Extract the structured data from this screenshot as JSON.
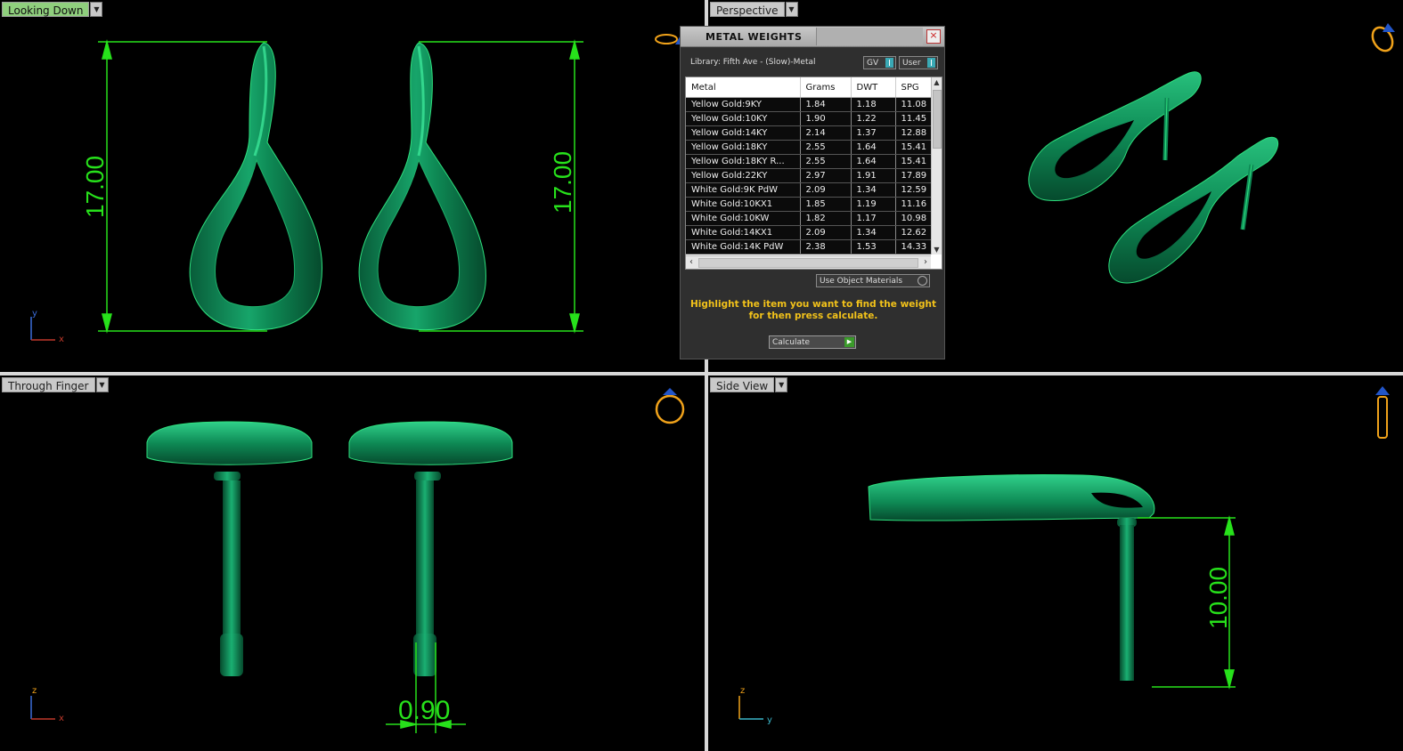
{
  "viewports": {
    "top_left": {
      "label": "Looking Down",
      "dim_left": "17.00",
      "dim_right": "17.00",
      "axis_a": "y",
      "axis_b": "x"
    },
    "top_right": {
      "label": "Perspective"
    },
    "bottom_left": {
      "label": "Through Finger",
      "dim": "0.90",
      "axis_a": "z",
      "axis_b": "x"
    },
    "bottom_right": {
      "label": "Side View",
      "dim": "10.00",
      "axis_a": "z",
      "axis_b": "y"
    }
  },
  "dialog": {
    "title": "METAL WEIGHTS",
    "close": "×",
    "library": "Library: Fifth Ave - (Slow)-Metal",
    "toggle_gv": "GV",
    "toggle_user": "User",
    "columns": [
      "Metal",
      "Grams",
      "DWT",
      "SPG"
    ],
    "rows": [
      [
        "Yellow Gold:9KY",
        "1.84",
        "1.18",
        "11.08"
      ],
      [
        "Yellow Gold:10KY",
        "1.90",
        "1.22",
        "11.45"
      ],
      [
        "Yellow Gold:14KY",
        "2.14",
        "1.37",
        "12.88"
      ],
      [
        "Yellow Gold:18KY",
        "2.55",
        "1.64",
        "15.41"
      ],
      [
        "Yellow Gold:18KY R...",
        "2.55",
        "1.64",
        "15.41"
      ],
      [
        "Yellow Gold:22KY",
        "2.97",
        "1.91",
        "17.89"
      ],
      [
        "White Gold:9K PdW",
        "2.09",
        "1.34",
        "12.59"
      ],
      [
        "White Gold:10KX1",
        "1.85",
        "1.19",
        "11.16"
      ],
      [
        "White Gold:10KW",
        "1.82",
        "1.17",
        "10.98"
      ],
      [
        "White Gold:14KX1",
        "2.09",
        "1.34",
        "12.62"
      ],
      [
        "White Gold:14K PdW",
        "2.38",
        "1.53",
        "14.33"
      ]
    ],
    "use_object_materials": "Use Object Materials",
    "hint": "Highlight the item you want to find the weight for then press calculate.",
    "calculate": "Calculate"
  },
  "colors": {
    "model": "#0b7a4c",
    "model_light": "#2ec583",
    "dimension": "#27e11b",
    "hint": "#f2c21a",
    "active_label": "#8fcf7d"
  },
  "icons": [
    "dropdown-arrow-icon",
    "ring-orientation-icon",
    "axis-triad-icon",
    "close-icon",
    "play-icon"
  ]
}
